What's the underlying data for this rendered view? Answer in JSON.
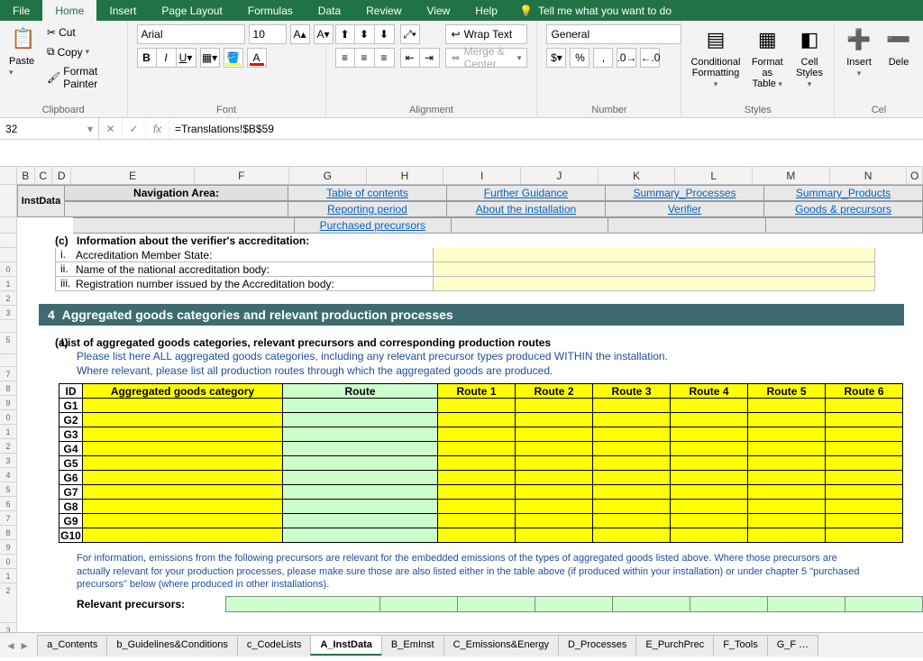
{
  "tabs": {
    "file": "File",
    "home": "Home",
    "insert": "Insert",
    "pageLayout": "Page Layout",
    "formulas": "Formulas",
    "data": "Data",
    "review": "Review",
    "view": "View",
    "help": "Help",
    "tellme": "Tell me what you want to do"
  },
  "clipboard": {
    "paste": "Paste",
    "cut": "Cut",
    "copy": "Copy",
    "formatPainter": "Format Painter",
    "label": "Clipboard"
  },
  "font": {
    "name": "Arial",
    "size": "10",
    "label": "Font"
  },
  "alignment": {
    "wrap": "Wrap Text",
    "merge": "Merge & Center",
    "label": "Alignment"
  },
  "number": {
    "format": "General",
    "label": "Number"
  },
  "styles": {
    "cond": "Conditional Formatting",
    "fmtTable": "Format as Table",
    "cell": "Cell Styles",
    "label": "Styles"
  },
  "cells": {
    "insert": "Insert",
    "delete": "Dele",
    "label": "Cel"
  },
  "nameBox": "32",
  "formula": "=Translations!$B$59",
  "colHdrs": [
    "B",
    "C",
    "D",
    "E",
    "F",
    "G",
    "H",
    "I",
    "J",
    "K",
    "L",
    "M",
    "N",
    "O"
  ],
  "nav": {
    "instData": "InstData",
    "navLabel": "Navigation Area:",
    "r1": [
      "Table of contents",
      "Further Guidance",
      "Summary_Processes",
      "Summary_Products"
    ],
    "r2": [
      "Reporting period",
      "About the installation",
      "Verifier",
      "Goods & precursors"
    ],
    "r3": [
      "Purchased precursors",
      "",
      "",
      ""
    ]
  },
  "secC": {
    "tag": "(c)",
    "title": "Information about the verifier's accreditation:",
    "rows": [
      {
        "n": "i.",
        "t": "Accreditation Member State:"
      },
      {
        "n": "ii.",
        "t": "Name of the national accreditation body:"
      },
      {
        "n": "iii.",
        "t": "Registration number issued by the Accreditation body:"
      }
    ]
  },
  "sec4": {
    "num": "4",
    "title": "Aggregated goods categories and relevant production processes"
  },
  "secA": {
    "tag": "(a)",
    "title": "List of aggregated goods categories, relevant precursors and corresponding production routes",
    "line1": "Please list here ALL aggregated goods categories, including any relevant precursor types produced WITHIN the installation.",
    "line2": "Where relevant, please list all production routes through which the aggregated goods are produced."
  },
  "goodsTable": {
    "headers": [
      "ID",
      "Aggregated goods category",
      "Route",
      "Route 1",
      "Route 2",
      "Route 3",
      "Route 4",
      "Route 5",
      "Route 6"
    ],
    "ids": [
      "G1",
      "G2",
      "G3",
      "G4",
      "G5",
      "G6",
      "G7",
      "G8",
      "G9",
      "G10"
    ]
  },
  "infoPara": "For information, emissions from the following precursors are relevant for the embedded emissions of the types of aggregated goods listed above. Where those precursors are actually relevant for your production processes, please make sure those are also listed either in the table above (if produced within your installation) or under chapter 5 \"purchased precursors\" below (where produced in other installations).",
  "relPrec": "Relevant precursors:",
  "sheetTabs": [
    "a_Contents",
    "b_Guidelines&Conditions",
    "c_CodeLists",
    "A_InstData",
    "B_EmInst",
    "C_Emissions&Energy",
    "D_Processes",
    "E_PurchPrec",
    "F_Tools",
    "G_F …"
  ],
  "activeSheet": "A_InstData"
}
